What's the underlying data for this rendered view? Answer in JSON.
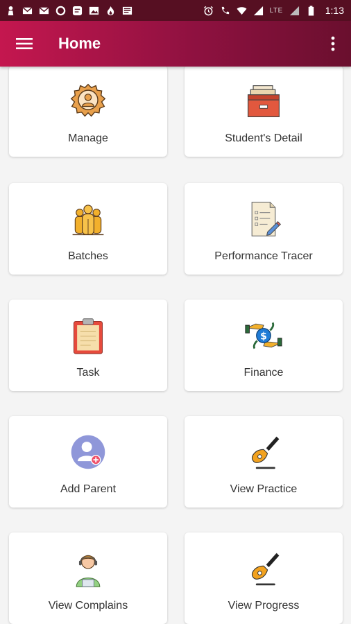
{
  "status_bar": {
    "time": "1:13",
    "network": "LTE",
    "left_icons": [
      "person-icon",
      "gmail-icon",
      "gmail-icon",
      "circle-icon",
      "chat-icon",
      "image-icon",
      "flame-icon",
      "news-icon"
    ],
    "right_icons": [
      "alarm-icon",
      "volte-icon",
      "wifi-icon",
      "signal-icon",
      "battery-icon"
    ]
  },
  "app_bar": {
    "title": "Home",
    "menu_icon": "hamburger-menu-icon",
    "more_icon": "more-vert-icon"
  },
  "tiles": [
    {
      "label": "Manage",
      "icon": "gear-user-icon"
    },
    {
      "label": "Student's Detail",
      "icon": "file-drawer-icon"
    },
    {
      "label": "Batches",
      "icon": "group-icon"
    },
    {
      "label": "Performance Tracer",
      "icon": "checklist-icon"
    },
    {
      "label": "Task",
      "icon": "clipboard-icon"
    },
    {
      "label": "Finance",
      "icon": "money-exchange-icon"
    },
    {
      "label": "Add Parent",
      "icon": "add-user-icon"
    },
    {
      "label": "View Practice",
      "icon": "guitar-icon"
    },
    {
      "label": "View Complains",
      "icon": "support-agent-icon"
    },
    {
      "label": "View Progress",
      "icon": "guitar-icon"
    }
  ],
  "colors": {
    "status_bar": "#560f22",
    "app_bar_start": "#c4174f",
    "app_bar_end": "#6a0f2e",
    "background": "#f4f4f4",
    "card": "#ffffff"
  }
}
